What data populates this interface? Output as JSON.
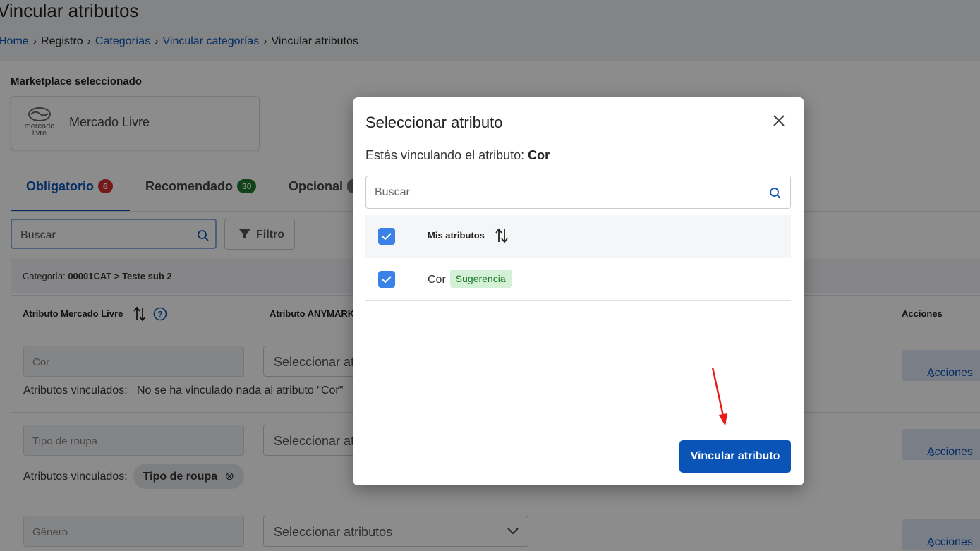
{
  "page": {
    "title": "Vincular atributos",
    "breadcrumb": [
      {
        "label": "Home",
        "link": true
      },
      {
        "label": "Registro",
        "link": false
      },
      {
        "label": "Categorías",
        "link": true
      },
      {
        "label": "Vincular categorías",
        "link": true
      },
      {
        "label": "Vincular atributos",
        "link": false
      }
    ],
    "marketplace_label": "Marketplace seleccionado",
    "marketplace": {
      "name": "Mercado Livre",
      "logo_line1": "mercado",
      "logo_line2": "livre"
    }
  },
  "tabs": [
    {
      "label": "Obligatorio",
      "count": "6",
      "color": "#d32f2f",
      "active": true
    },
    {
      "label": "Recomendado",
      "count": "30",
      "color": "#1f7a2f",
      "active": false
    },
    {
      "label": "Opcional",
      "count": "",
      "color": "#777777",
      "active": false
    }
  ],
  "toolbar": {
    "search_placeholder": "Buscar",
    "filter_label": "Filtro"
  },
  "category": {
    "prefix": "Categoría:",
    "value": "00001CAT > Teste sub 2"
  },
  "table": {
    "col_ml": "Atributo Mercado Livre",
    "col_any": "Atributo ANYMARKE",
    "col_actions": "Acciones"
  },
  "rows": [
    {
      "attr": "Cor",
      "select": "Seleccionar at",
      "linked_label": "Atributos vinculados:",
      "linked_text": "No se ha vinculado nada al atributo \"Cor\"",
      "actions": "Acciones"
    },
    {
      "attr": "Tipo de roupa",
      "select": "Seleccionar at",
      "linked_label": "Atributos vinculados:",
      "chip": "Tipo de roupa",
      "actions": "Acciones"
    },
    {
      "attr": "Gênero",
      "select": "Seleccionar atributos",
      "actions": "Acciones"
    }
  ],
  "modal": {
    "title": "Seleccionar atributo",
    "desc_prefix": "Estás vinculando el atributo:",
    "desc_attr": "Cor",
    "search_placeholder": "Buscar",
    "col_header": "Mis atributos",
    "items": [
      {
        "label": "Cor",
        "badge": "Sugerencia",
        "checked": true
      }
    ],
    "submit": "Vincular atributo"
  },
  "colors": {
    "primary": "#0a54b8",
    "checkbox": "#3b82e8",
    "annotation_arrow": "#e81b1b"
  }
}
